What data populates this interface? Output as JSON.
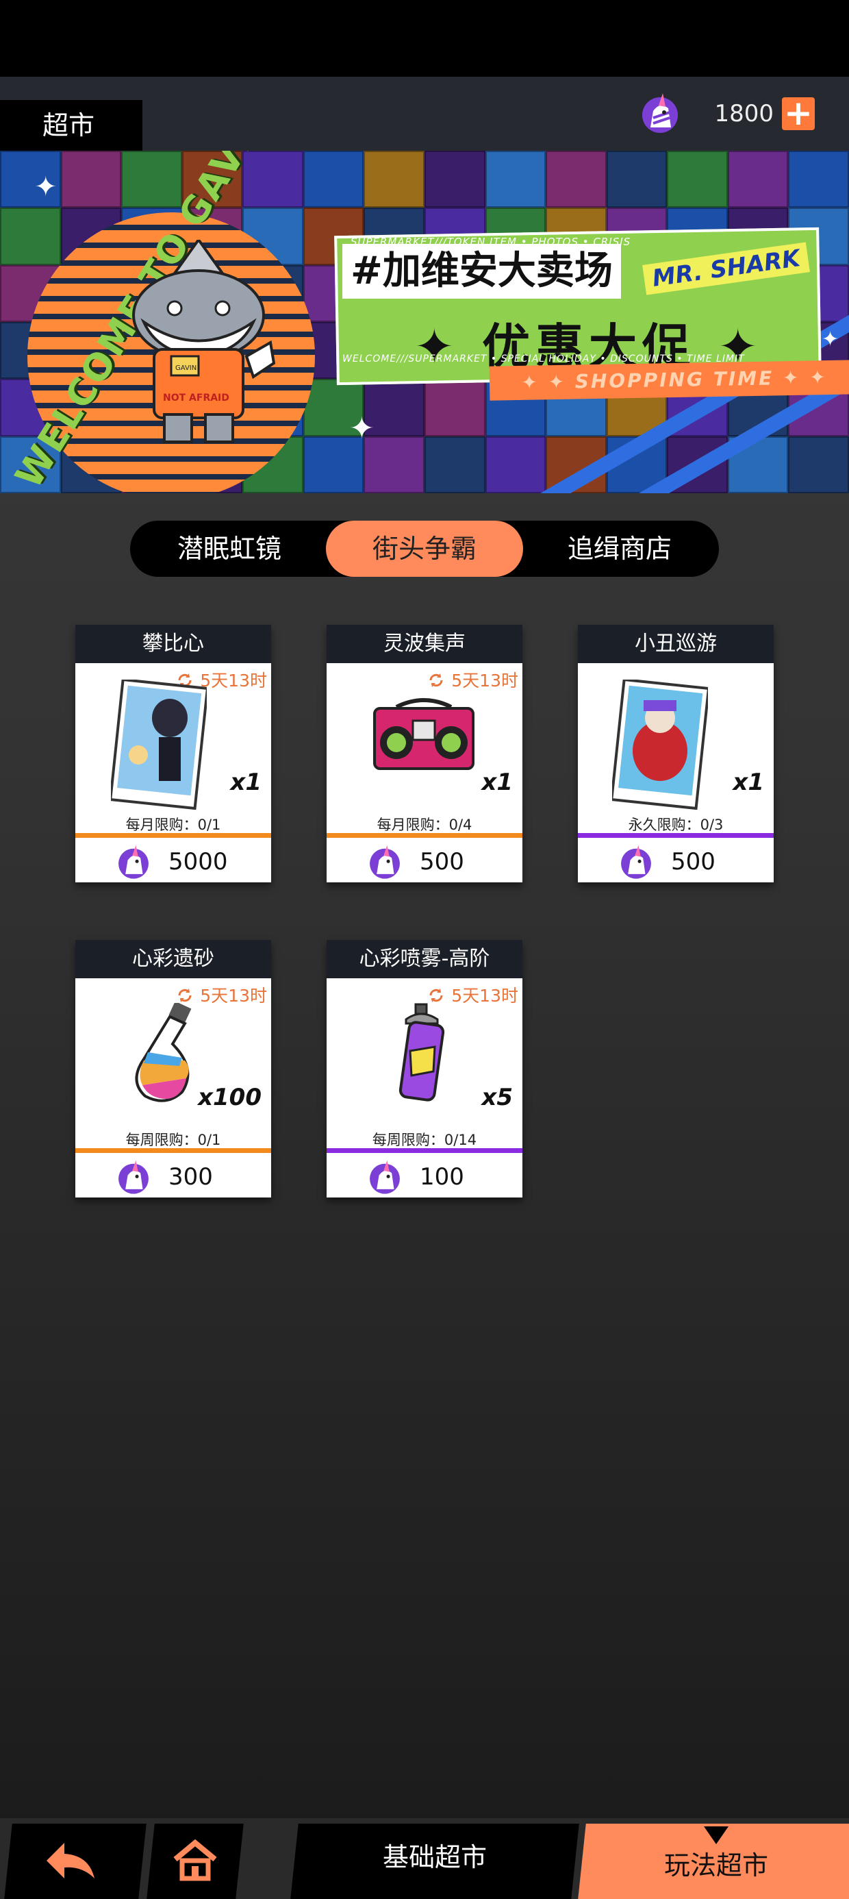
{
  "header": {
    "title": "超市",
    "currency_icon": "unicorn-coin-icon",
    "currency_amount": "1800",
    "add_icon": "plus-icon"
  },
  "banner": {
    "welcome_text": "WELCOME TO GAVIN CITY",
    "hashtag_title": "#加维安大卖场",
    "mascot_label": "MR. SHARK",
    "promo_text": "✦ 优惠大促 ✦",
    "tagline_top": "SUPERMARKET///TOKEN ITEM • PHOTOS • CRISIS",
    "tagline_bottom": "WELCOME///SUPERMARKET • SPECIAL HOLIDAY • DISCOUNTS • TIME LIMIT",
    "stripe_text": "✦ ✦ SHOPPING TIME ✦ ✦",
    "shirt_text": "NOT AFRAID",
    "chain_text": "GAVIN"
  },
  "tabs": [
    {
      "label": "潜眠虹镜",
      "active": false
    },
    {
      "label": "街头争霸",
      "active": true
    },
    {
      "label": "追缉商店",
      "active": false
    }
  ],
  "products": [
    {
      "name": "攀比心",
      "timer": "5天13时",
      "qty": "x1",
      "limit": "每月限购：0/1",
      "price": "5000",
      "rule_color": "#f28a1e",
      "icon": "character-card-icon"
    },
    {
      "name": "灵波集声",
      "timer": "5天13时",
      "qty": "x1",
      "limit": "每月限购：0/4",
      "price": "500",
      "rule_color": "#f28a1e",
      "icon": "boombox-icon"
    },
    {
      "name": "小丑巡游",
      "timer": "",
      "qty": "x1",
      "limit": "永久限购：0/3",
      "price": "500",
      "rule_color": "#8a2be2",
      "icon": "clown-card-icon"
    },
    {
      "name": "心彩遗砂",
      "timer": "5天13时",
      "qty": "x100",
      "limit": "每周限购：0/1",
      "price": "300",
      "rule_color": "#f28a1e",
      "icon": "rainbow-sand-bottle-icon"
    },
    {
      "name": "心彩喷雾-高阶",
      "timer": "5天13时",
      "qty": "x5",
      "limit": "每周限购：0/14",
      "price": "100",
      "rule_color": "#8a2be2",
      "icon": "spray-can-icon"
    }
  ],
  "bottom_nav": {
    "back_icon": "back-arrow-icon",
    "home_icon": "home-icon",
    "basic_label": "基础超市",
    "play_label": "玩法超市",
    "active_marker_icon": "triangle-down-icon"
  },
  "colors": {
    "accent": "#ff8a5c",
    "timer": "#e8743a",
    "dark": "#1b1f27"
  }
}
